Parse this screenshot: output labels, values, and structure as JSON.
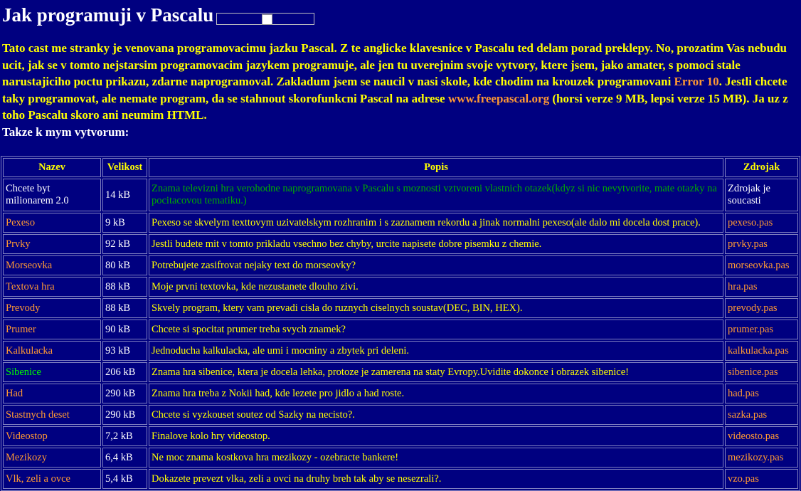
{
  "title": "Jak programuji v Pascalu",
  "intro": {
    "text1": "Tato cast me stranky je venovana programovacimu jazku Pascal. Z te anglicke klavesnice v Pascalu ted delam porad preklepy. No, prozatim Vas nebudu ucit, jak se v tomto nejstarsim programovacim jazykem programuje, ale jen tu uverejnim svoje vytvory, ktere jsem, jako amater, s pomoci stale narustajiciho poctu prikazu, zdarne naprogramoval. Zakladum jsem se naucil v nasi skole, kde chodim na krouzek programovani ",
    "link1": "Error 10",
    "text2": ". Jestli chcete taky programovat, ale nemate program, da se stahnout skorofunkcni Pascal na adrese ",
    "link2": "www.freepascal.org",
    "text3": " (horsi verze 9 MB, lepsi verze 15 MB). Ja uz z toho Pascalu skoro ani neumim HTML.",
    "text4": "Takze k mym vytvorum:"
  },
  "table": {
    "headers": {
      "name": "Nazev",
      "size": "Velikost",
      "desc": "Popis",
      "src": "Zdrojak"
    },
    "rows": [
      {
        "name": "Chcete byt milionarem 2.0",
        "size": "14 kB",
        "desc": "Znama televizni hra verohodne naprogramovana v Pascalu s moznosti vztvoreni vlastnich otazek(kdyz si nic nevytvorite, mate otazky na pocitacovou tematiku.)",
        "src": "Zdrojak je soucasti"
      },
      {
        "name": "Pexeso",
        "size": "9 kB",
        "desc": "Pexeso se skvelym texttovym uzivatelskym rozhranim i s zaznamem rekordu a jinak normalni pexeso(ale dalo mi docela dost prace).",
        "src": "pexeso.pas"
      },
      {
        "name": "Prvky",
        "size": "92 kB",
        "desc": "Jestli budete mit v tomto prikladu vsechno bez chyby, urcite napisete dobre pisemku z chemie.",
        "src": "prvky.pas"
      },
      {
        "name": "Morseovka",
        "size": "80 kB",
        "desc": "Potrebujete zasifrovat nejaky text do morseovky?",
        "src": "morseovka.pas"
      },
      {
        "name": "Textova hra",
        "size": "88 kB",
        "desc": "Moje prvni textovka, kde nezustanete dlouho zivi.",
        "src": "hra.pas"
      },
      {
        "name": "Prevody",
        "size": "88 kB",
        "desc": "Skvely program, ktery vam prevadi cisla do ruznych ciselnych soustav(DEC, BIN, HEX).",
        "src": "prevody.pas"
      },
      {
        "name": "Prumer",
        "size": "90 kB",
        "desc": "Chcete si spocitat prumer treba svych znamek?",
        "src": "prumer.pas"
      },
      {
        "name": "Kalkulacka",
        "size": "93 kB",
        "desc": "Jednoducha kalkulacka, ale umi i mocniny a zbytek pri deleni.",
        "src": "kalkulacka.pas"
      },
      {
        "name": "Sibenice",
        "size": "206 kB",
        "desc": "Znama hra sibenice, ktera je docela lehka, protoze je zamerena na staty Evropy.Uvidite dokonce i obrazek sibenice!",
        "src": "sibenice.pas"
      },
      {
        "name": "Had",
        "size": "290 kB",
        "desc": "Znama hra treba z Nokii had, kde lezete pro jidlo a had roste.",
        "src": "had.pas"
      },
      {
        "name": "Stastnych deset",
        "size": "290 kB",
        "desc": "Chcete si vyzkouset soutez od Sazky na necisto?.",
        "src": "sazka.pas"
      },
      {
        "name": "Videostop",
        "size": "7,2 kB",
        "desc": "Finalove kolo hry videostop.",
        "src": "videosto.pas"
      },
      {
        "name": "Mezikozy",
        "size": "6,4 kB",
        "desc": "Ne moc znama kostkova hra mezikozy - ozebracte bankere!",
        "src": "mezikozy.pas"
      },
      {
        "name": "Vlk, zeli a ovce",
        "size": "5,4 kB",
        "desc": "Dokazete prevezt vlka, zeli a ovci na druhy breh tak aby se nesezrali?.",
        "src": "vzo.pas"
      }
    ]
  },
  "colors": {
    "background": "#000080",
    "text": "#ffff00",
    "link": "#ff9933",
    "accent_green": "#00ff00"
  }
}
